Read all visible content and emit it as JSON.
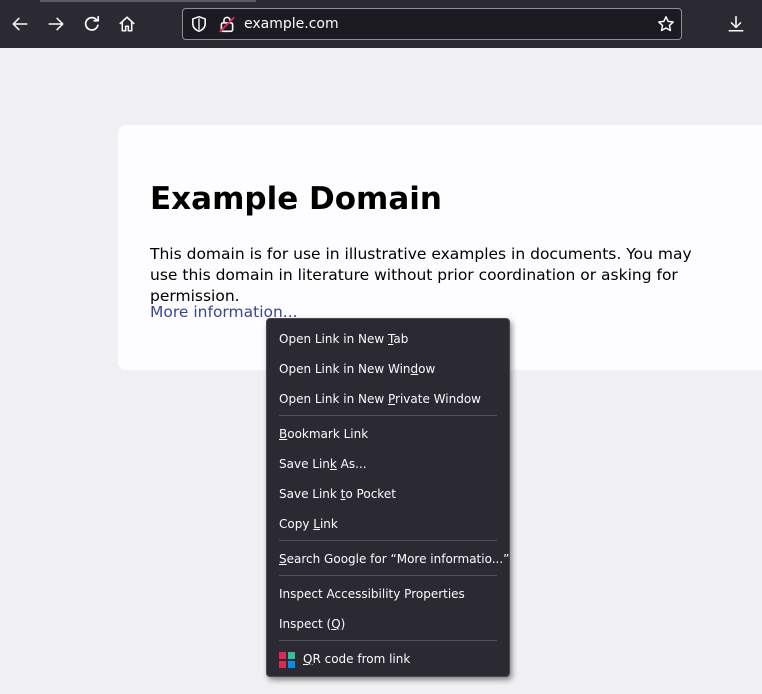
{
  "browser": {
    "url": "example.com",
    "icons": {
      "back": "arrow-left-icon",
      "forward": "arrow-right-icon",
      "reload": "reload-icon",
      "home": "home-icon",
      "tracking_protection": "shield-icon",
      "connection": "lock-icon",
      "bookmark": "star-icon",
      "downloads": "download-icon"
    },
    "colors": {
      "toolbar": "#2b2a33",
      "urlbar": "#1c1b22",
      "page_background": "#f0f0f2"
    }
  },
  "page": {
    "heading": "Example Domain",
    "paragraph": "This domain is for use in illustrative examples in documents. You may use this domain in literature without prior coordination or asking for permission.",
    "link": "More information...",
    "colors": {
      "link": "#38488f",
      "card": "#fdfdff"
    }
  },
  "context_menu": {
    "items": [
      {
        "pre": "Open Link in New ",
        "key": "T",
        "post": "ab"
      },
      {
        "pre": "Open Link in New Win",
        "key": "d",
        "post": "ow"
      },
      {
        "pre": "Open Link in New ",
        "key": "P",
        "post": "rivate Window"
      },
      {
        "pre": "",
        "key": "B",
        "post": "ookmark Link"
      },
      {
        "pre": "Save Lin",
        "key": "k",
        "post": " As..."
      },
      {
        "pre": "Save Link ",
        "key": "t",
        "post": "o Pocket"
      },
      {
        "pre": "Copy ",
        "key": "L",
        "post": "ink"
      },
      {
        "pre": "",
        "key": "S",
        "post": "earch Google for “More informatio...”"
      },
      {
        "pre": "Inspect Accessibility Properties",
        "key": "",
        "post": ""
      },
      {
        "pre": "Inspect (",
        "key": "Q",
        "post": ")"
      },
      {
        "pre": "",
        "key": "Q",
        "post": "R code from link",
        "icon": "qr-code-icon"
      }
    ],
    "colors": {
      "background": "#2b2a33",
      "text": "#fbfbfe",
      "qr_icon": [
        "#e22850",
        "#2ac3a2",
        "#0090ed",
        "#e22850"
      ]
    }
  }
}
